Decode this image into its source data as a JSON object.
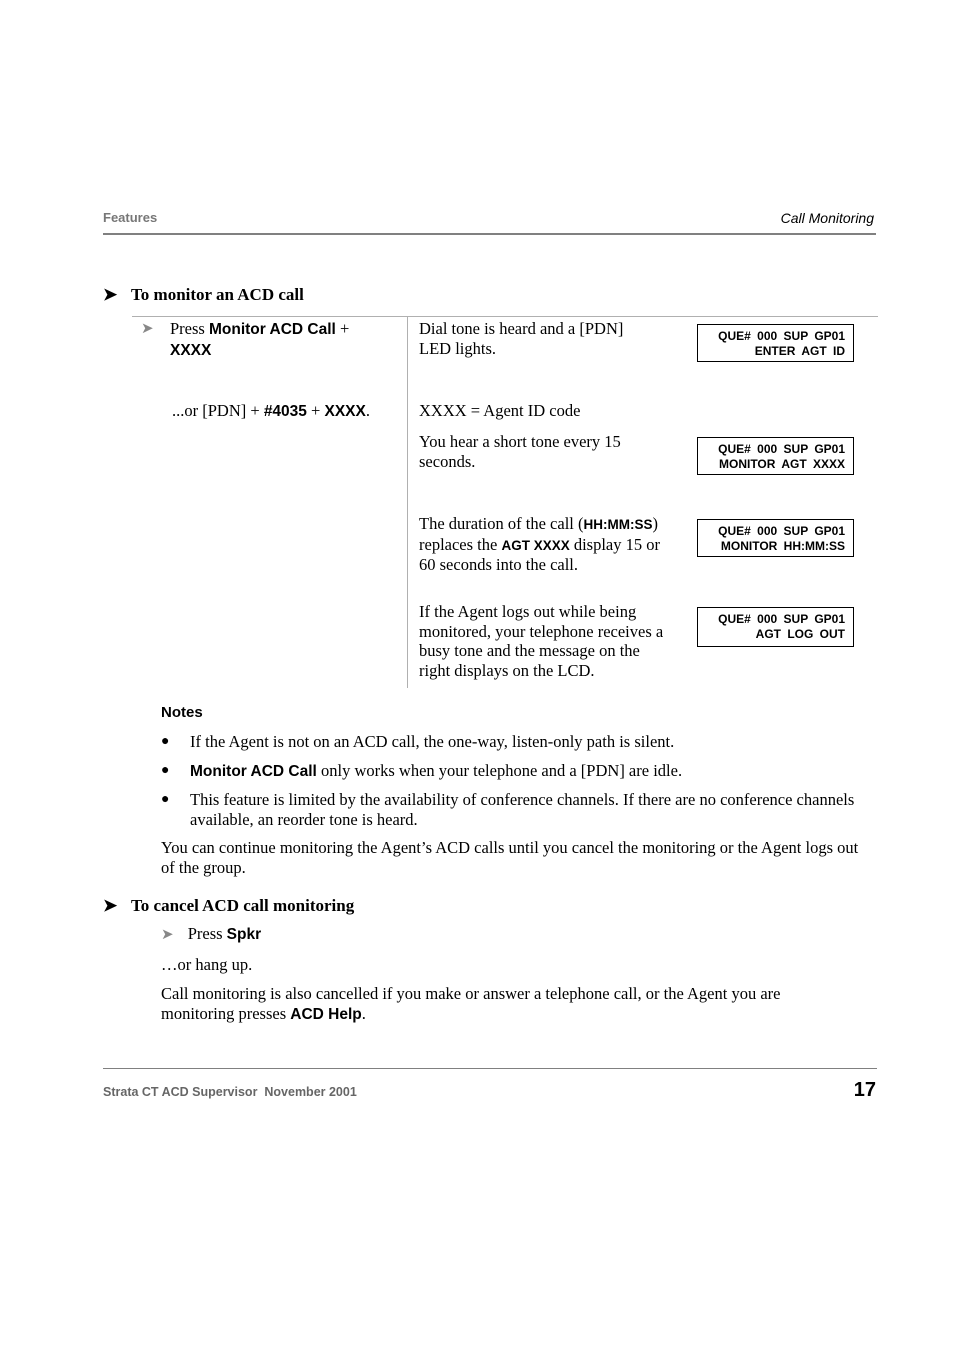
{
  "header": {
    "section": "Features",
    "topic": "Call Monitoring"
  },
  "monitor_section": {
    "heading": "To monitor an ACD call",
    "arrow_icon": "right-arrowhead",
    "steps": {
      "step1_prefix": "Press ",
      "step1_key": "Monitor ACD Call",
      "step1_plus": " +",
      "step1_code": "XXXX",
      "alt_prefix": "...or [PDN] + ",
      "alt_key": "#4035",
      "alt_plus": " + ",
      "alt_code": "XXXX",
      "alt_suffix": "."
    },
    "descriptions": [
      {
        "text": "Dial tone is heard and a [PDN] LED lights."
      },
      {
        "text": "XXXX = Agent ID code"
      },
      {
        "text": "You hear a short tone every 15 seconds."
      },
      {
        "pre": "The duration of the call (",
        "b1": "HH:MM:SS",
        "mid": ") replaces the ",
        "b2": "AGT XXXX",
        "post": " display 15 or 60 seconds into the call."
      },
      {
        "text": "If the Agent logs out while being monitored, your telephone receives a busy tone and the message on the right displays on the LCD."
      }
    ],
    "lcd_displays": [
      {
        "line1": "QUE# 000 SUP GP01",
        "line2": "ENTER AGT ID"
      },
      {
        "line1": "QUE# 000 SUP GP01",
        "line2": "MONITOR AGT XXXX"
      },
      {
        "line1": "QUE# 000 SUP GP01",
        "line2": "MONITOR HH:MM:SS"
      },
      {
        "line1": "QUE# 000 SUP GP01",
        "line2": "AGT LOG OUT"
      }
    ]
  },
  "notes": {
    "heading": "Notes",
    "items": [
      {
        "text": "If the Agent is not on an ACD call, the one-way, listen-only path is silent."
      },
      {
        "bold": "Monitor ACD Call",
        "text": " only works when your telephone and a [PDN] are idle."
      },
      {
        "text": "This feature is limited by the availability of conference channels. If there are no conference channels available, an reorder tone is heard."
      }
    ],
    "paragraph": "You can continue monitoring the Agent’s ACD calls until you cancel the monitoring or the Agent logs out of the group."
  },
  "cancel_section": {
    "heading": "To cancel ACD call monitoring",
    "step_prefix": "Press ",
    "step_key": "Spkr",
    "alt": "…or hang up.",
    "para_pre": "Call monitoring is also cancelled if you make or answer a telephone call, or the Agent you are monitoring presses ",
    "para_key": "ACD Help",
    "para_post": "."
  },
  "footer": {
    "doc_title": "Strata CT ACD Supervisor  November 2001",
    "page_number": "17"
  }
}
